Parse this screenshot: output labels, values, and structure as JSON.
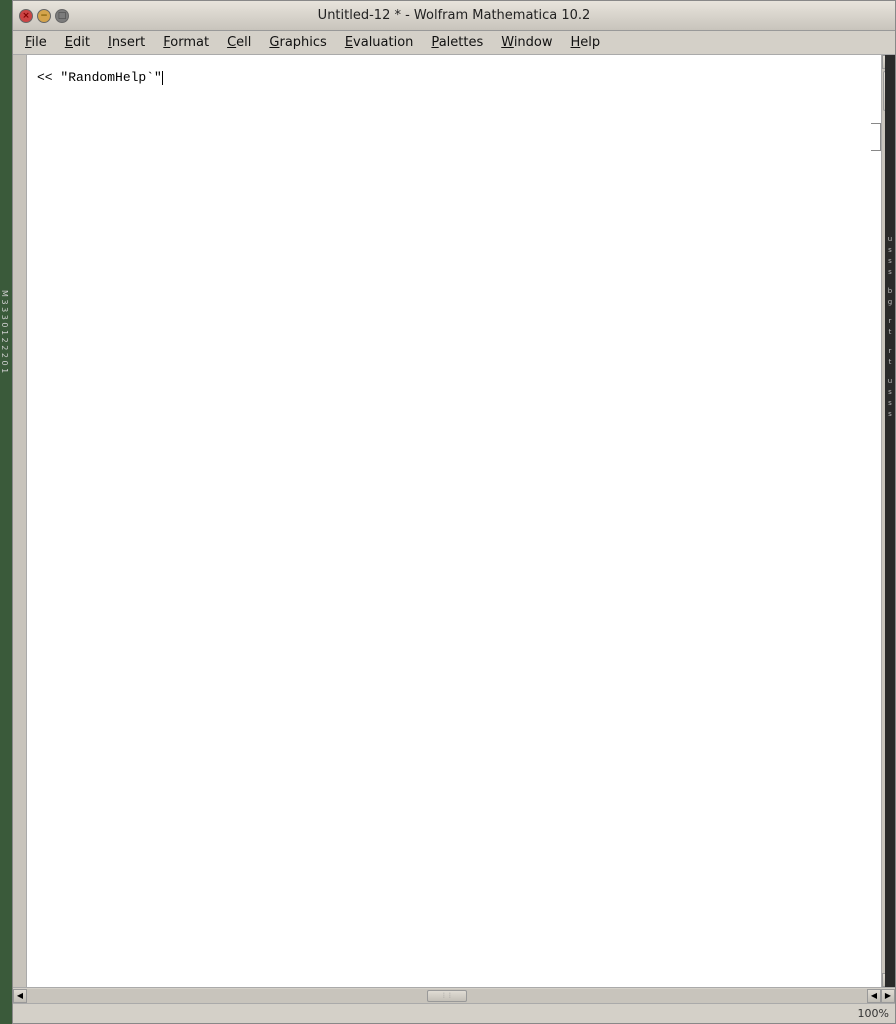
{
  "window": {
    "title": "Untitled-12 * - Wolfram Mathematica 10.2",
    "title_btn_close": "×",
    "title_btn_min": "−",
    "title_btn_max": "□"
  },
  "menubar": {
    "items": [
      {
        "id": "file",
        "label": "File",
        "underline_index": 0
      },
      {
        "id": "edit",
        "label": "Edit",
        "underline_index": 0
      },
      {
        "id": "insert",
        "label": "Insert",
        "underline_index": 0
      },
      {
        "id": "format",
        "label": "Format",
        "underline_index": 0
      },
      {
        "id": "cell",
        "label": "Cell",
        "underline_index": 0
      },
      {
        "id": "graphics",
        "label": "Graphics",
        "underline_index": 0
      },
      {
        "id": "evaluation",
        "label": "Evaluation",
        "underline_index": 0
      },
      {
        "id": "palettes",
        "label": "Palettes",
        "underline_index": 0
      },
      {
        "id": "window",
        "label": "Window",
        "underline_index": 0
      },
      {
        "id": "help",
        "label": "Help",
        "underline_index": 0
      }
    ]
  },
  "notebook": {
    "cell_content": "<< \"RandomHelp`\"",
    "cursor_visible": true
  },
  "scrollbar": {
    "up_arrow": "▲",
    "down_arrow": "▼",
    "left_arrow": "◀",
    "right_arrow": "▶"
  },
  "status_bar": {
    "zoom": "100%"
  },
  "right_panel_letters": [
    "u",
    "s",
    "s",
    "s",
    "b",
    "g",
    "r",
    "t",
    "r",
    "t",
    "u",
    "s",
    "s",
    "s"
  ]
}
